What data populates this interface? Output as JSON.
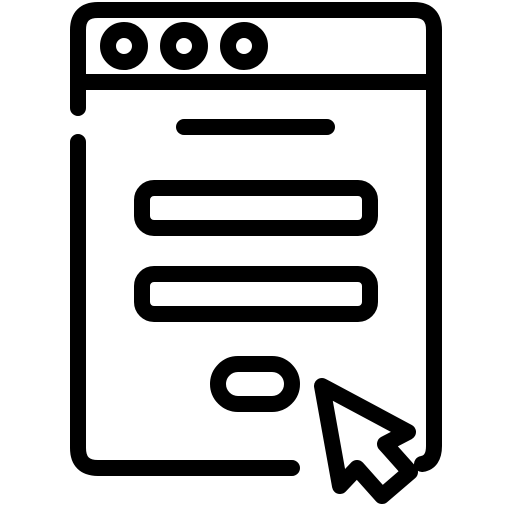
{
  "icon": {
    "name": "web-login-form-icon",
    "stroke_color": "#000000",
    "background_color": "#ffffff",
    "window_control_dots": 3,
    "input_fields": 2,
    "elements": [
      "browser-window-frame",
      "title-bar",
      "window-control-dots",
      "heading-line",
      "username-input-field",
      "password-input-field",
      "submit-button",
      "mouse-cursor"
    ]
  }
}
